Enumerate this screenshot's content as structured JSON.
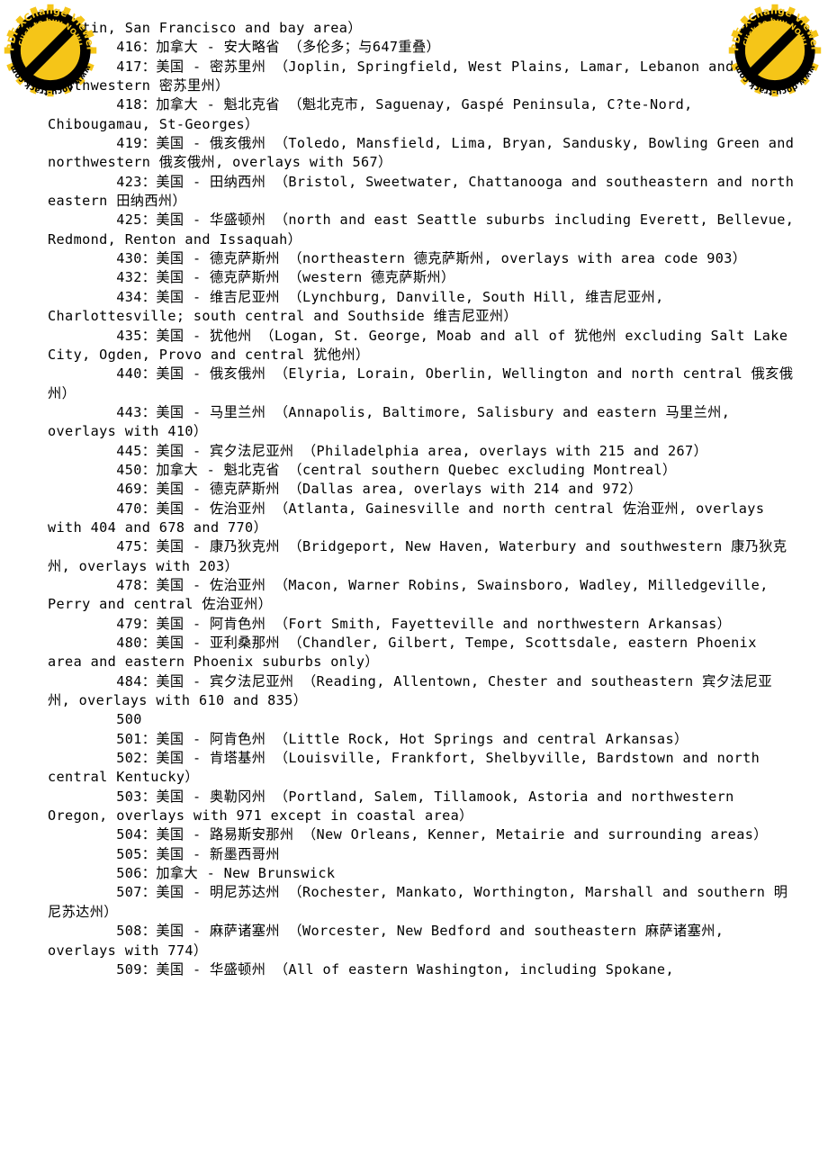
{
  "document": {
    "type": "pdf-page",
    "background_color": "#ffffff",
    "text_color": "#000000",
    "font_style": "monospace"
  },
  "watermark": {
    "icon": "prohibition-gear-badge-icon",
    "brand": "PDF-XChange Viewer",
    "call_to_action": "Click to buy NOW!",
    "url": "www.docu-track.com",
    "gear_color": "#F5C518",
    "ring_color": "#000000",
    "positions": [
      "top-left",
      "top-right"
    ]
  },
  "content": {
    "lines": [
      "Quentin, San Francisco and bay area）",
      "        416：加拿大 - 安大略省 （多伦多；与647重叠）",
      "        417：美国 - 密苏里州 （Joplin, Springfield, West Plains, Lamar, Lebanon and southwestern 密苏里州）",
      "        418：加拿大 - 魁北克省 （魁北克市, Saguenay, Gaspé Peninsula, C?te-Nord, Chibougamau, St-Georges）",
      "        419：美国 - 俄亥俄州 （Toledo, Mansfield, Lima, Bryan, Sandusky, Bowling Green and northwestern 俄亥俄州, overlays with 567）",
      "        423：美国 - 田纳西州 （Bristol, Sweetwater, Chattanooga and southeastern and north eastern 田纳西州）",
      "        425：美国 - 华盛顿州 （north and east Seattle suburbs including Everett, Bellevue, Redmond, Renton and Issaquah）",
      "        430：美国 - 德克萨斯州 （northeastern 德克萨斯州, overlays with area code 903）",
      "        432：美国 - 德克萨斯州 （western 德克萨斯州）",
      "        434：美国 - 维吉尼亚州 （Lynchburg, Danville, South Hill, 维吉尼亚州, Charlottesville; south central and Southside 维吉尼亚州）",
      "        435：美国 - 犹他州 （Logan, St. George, Moab and all of 犹他州 excluding Salt Lake City, Ogden, Provo and central 犹他州）",
      "        440：美国 - 俄亥俄州 （Elyria, Lorain, Oberlin, Wellington and north central 俄亥俄州）",
      "        443：美国 - 马里兰州 （Annapolis, Baltimore, Salisbury and eastern 马里兰州, overlays with 410）",
      "        445：美国 - 宾夕法尼亚州 （Philadelphia area, overlays with 215 and 267）",
      "        450：加拿大 - 魁北克省 （central southern Quebec excluding Montreal）",
      "        469：美国 - 德克萨斯州 （Dallas area, overlays with 214 and 972）",
      "        470：美国 - 佐治亚州 （Atlanta, Gainesville and north central 佐治亚州, overlays with 404 and 678 and 770）",
      "        475：美国 - 康乃狄克州 （Bridgeport, New Haven, Waterbury and southwestern 康乃狄克州, overlays with 203）",
      "        478：美国 - 佐治亚州 （Macon, Warner Robins, Swainsboro, Wadley, Milledgeville, Perry and central 佐治亚州）",
      "        479：美国 - 阿肯色州 （Fort Smith, Fayetteville and northwestern Arkansas）",
      "        480：美国 - 亚利桑那州 （Chandler, Gilbert, Tempe, Scottsdale, eastern Phoenix area and eastern Phoenix suburbs only）",
      "        484：美国 - 宾夕法尼亚州 （Reading, Allentown, Chester and southeastern 宾夕法尼亚州, overlays with 610 and 835）",
      "        500",
      "        501：美国 - 阿肯色州 （Little Rock, Hot Springs and central Arkansas）",
      "        502：美国 - 肯塔基州 （Louisville, Frankfort, Shelbyville, Bardstown and north central Kentucky）",
      "        503：美国 - 奥勒冈州 （Portland, Salem, Tillamook, Astoria and northwestern Oregon, overlays with 971 except in coastal area）",
      "        504：美国 - 路易斯安那州 （New Orleans, Kenner, Metairie and surrounding areas）",
      "        505：美国 - 新墨西哥州",
      "        506：加拿大 - New Brunswick",
      "        507：美国 - 明尼苏达州 （Rochester, Mankato, Worthington, Marshall and southern 明尼苏达州）",
      "        508：美国 - 麻萨诸塞州 （Worcester, New Bedford and southeastern 麻萨诸塞州, overlays with 774）",
      "        509：美国 - 华盛顿州 （All of eastern Washington, including Spokane,"
    ]
  }
}
